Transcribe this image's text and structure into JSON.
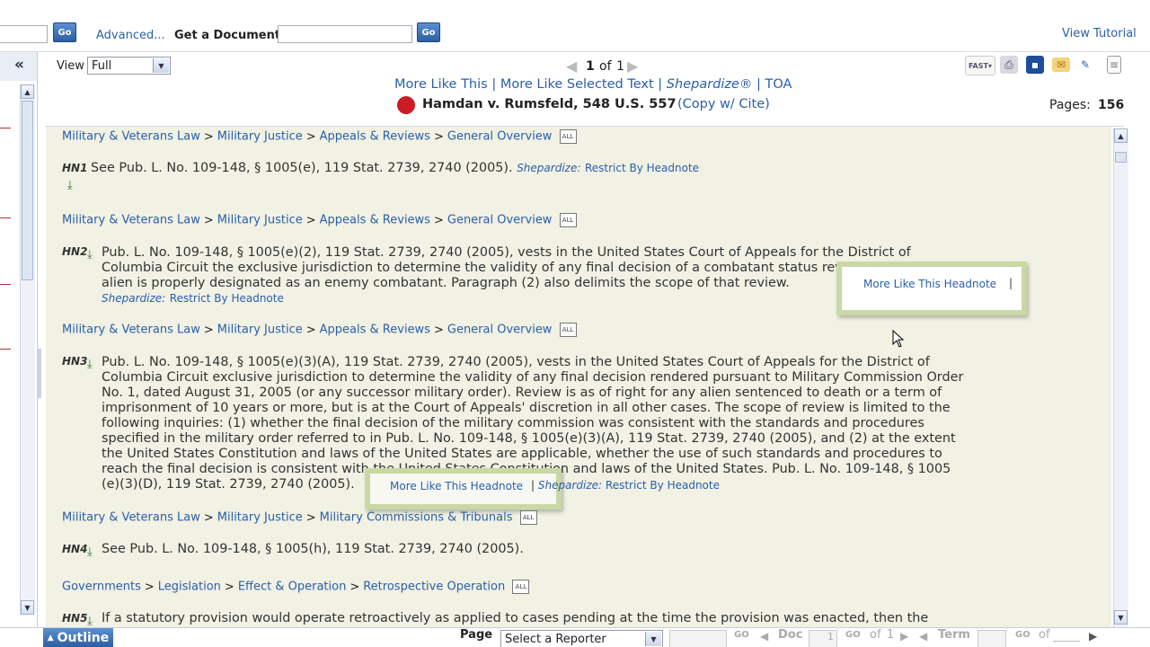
{
  "search": {
    "go_label": "Go",
    "advanced": "Advanced...",
    "get_document_label": "Get a Document",
    "view_tutorial": "View Tutorial"
  },
  "viewbar": {
    "view_label": "View",
    "view_value": "Full",
    "page_current": "1",
    "page_of": "of",
    "page_total": "1",
    "more_like_this": "More Like This",
    "more_like_selected": "More Like Selected Text",
    "shepardize": "Shepardize®",
    "toa": "TOA",
    "sep": "|",
    "case_title": "Hamdan v. Rumsfeld, 548 U.S. 557",
    "copy_cite": "(Copy w/ Cite)",
    "pages_label": "Pages:",
    "pages_value": "156",
    "collapse": "«"
  },
  "crumbs": {
    "mvl": "Military & Veterans Law",
    "mj": "Military Justice",
    "ar": "Appeals & Reviews",
    "go": "General Overview",
    "mct": "Military Commissions & Tribunals",
    "gov": "Governments",
    "leg": "Legislation",
    "eo": "Effect & Operation",
    "ro": "Retrospective Operation",
    "gt": ">"
  },
  "headnotes": {
    "hn1": {
      "label": "HN1",
      "text": "See Pub. L. No. 109-148, § 1005(e), 119 Stat. 2739, 2740 (2005)."
    },
    "hn2": {
      "label": "HN2",
      "l1": "Pub. L. No. 109-148, § 1005(e)(2), 119 Stat. 2739, 2740 (2005), vests in the United States Court of Appeals for the District of",
      "l2": "Columbia Circuit the exclusive jurisdiction to determine the validity of any final decision of a combatant status review tribunal that an",
      "l3": "alien is properly designated as an enemy combatant. Paragraph (2) also delimits the scope of that review."
    },
    "hn3": {
      "label": "HN3",
      "l1": "Pub. L. No. 109-148, § 1005(e)(3)(A), 119 Stat. 2739, 2740 (2005), vests in the United States Court of Appeals for the District of",
      "l2": "Columbia Circuit exclusive jurisdiction to determine the validity of any final decision rendered pursuant to Military Commission Order",
      "l3": "No. 1, dated August 31, 2005 (or any successor military order). Review is as of right for any alien sentenced to death or a term of",
      "l4": "imprisonment of 10 years or more, but is at the Court of Appeals' discretion in all other cases. The scope of review is limited to the",
      "l5": "following inquiries: (1) whether the final decision of the military commission was consistent with the standards and procedures",
      "l6": "specified in the military order referred to in Pub. L. No. 109-148, § 1005(e)(3)(A), 119 Stat. 2739, 2740 (2005), and (2) at the extent",
      "l7": "the United States Constitution and laws of the United States are applicable, whether the use of such standards and procedures to",
      "l8": "reach the final decision is consistent with the United States Constitution and laws of the United States. Pub. L. No. 109-148, § 1005",
      "l9": "(e)(3)(D), 119 Stat. 2739, 2740 (2005)."
    },
    "hn4": {
      "label": "HN4",
      "text": "See Pub. L. No. 109-148, § 1005(h), 119 Stat. 2739, 2740 (2005)."
    },
    "hn5": {
      "label": "HN5",
      "text": "If a statutory provision would operate retroactively as applied to cases pending at the time the provision was enacted, then the"
    },
    "shepardize_label": "Shepardize:",
    "restrict": "Restrict By Headnote",
    "more_like_headnote": "More Like This Headnote",
    "all_icon": "ALL"
  },
  "bottom": {
    "outline": "Outline",
    "page_label": "Page",
    "reporter_select": "Select a Reporter",
    "doc_label": "Doc",
    "doc_value": "1",
    "of_label": "of",
    "doc_total": "1",
    "term_label": "Term",
    "go_small": "GO"
  }
}
